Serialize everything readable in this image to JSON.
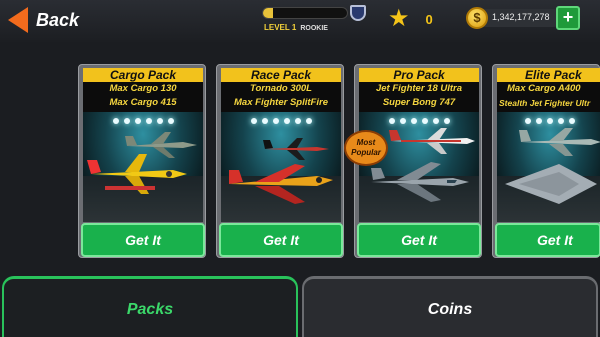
{
  "header": {
    "back_label": "Back",
    "level_label": "LEVEL 1",
    "rank_label": "ROOKIE",
    "xp_progress": 0.12,
    "stars": "0",
    "coins": "1,342,177,278",
    "coin_symbol": "$",
    "add_symbol": "+"
  },
  "packs": [
    {
      "title": "Cargo Pack",
      "lines": [
        "Max Cargo 130",
        "Max Cargo 415"
      ],
      "button": "Get It"
    },
    {
      "title": "Race Pack",
      "lines": [
        "Tornado 300L",
        "Max Fighter SplitFire"
      ],
      "button": "Get It"
    },
    {
      "title": "Pro Pack",
      "lines": [
        "Jet Fighter 18 Ultra",
        "Super Bong 747"
      ],
      "button": "Get It"
    },
    {
      "title": "Elite Pack",
      "lines": [
        "Max Cargo A400",
        "Stealth Jet Fighter Ultr"
      ],
      "button": "Get It"
    }
  ],
  "badge": {
    "line1": "Most",
    "line2": "Popular"
  },
  "tabs": [
    {
      "label": "Packs",
      "active": true
    },
    {
      "label": "Coins",
      "active": false
    }
  ],
  "colors": {
    "accent_green": "#19b14c",
    "title_yellow": "#f2c21c",
    "back_orange": "#f26b1d"
  }
}
